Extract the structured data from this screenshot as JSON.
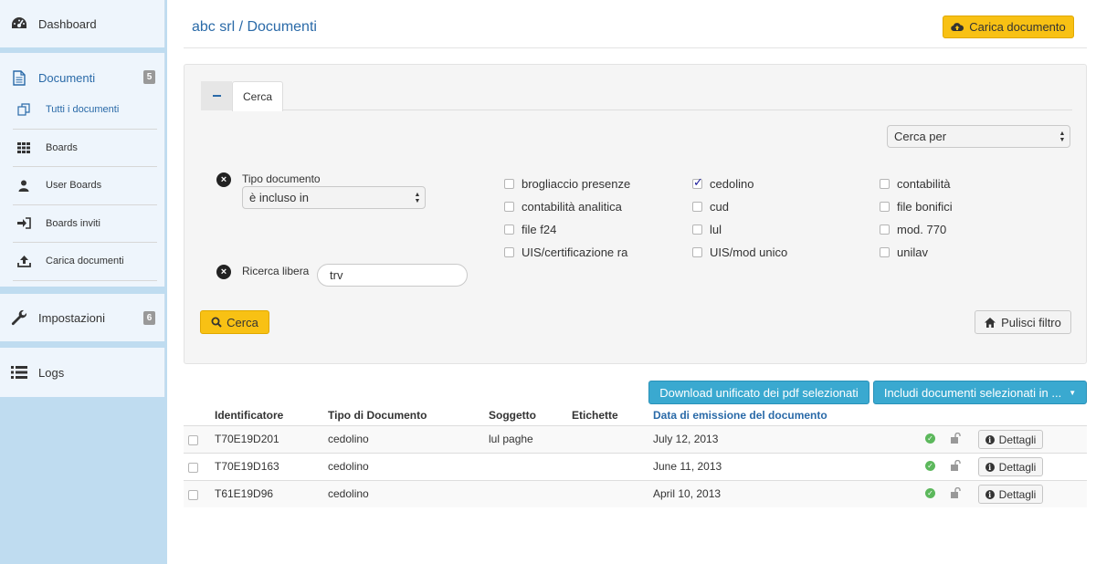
{
  "sidebar": {
    "dashboard": "Dashboard",
    "documenti": {
      "label": "Documenti",
      "badge": "5"
    },
    "sub_items": [
      {
        "label": "Tutti i documenti",
        "icon": "copy-icon"
      },
      {
        "label": "Boards",
        "icon": "grid-icon"
      },
      {
        "label": "User Boards",
        "icon": "user-icon"
      },
      {
        "label": "Boards inviti",
        "icon": "sign-in-icon"
      },
      {
        "label": "Carica documenti",
        "icon": "upload-icon"
      }
    ],
    "impostazioni": {
      "label": "Impostazioni",
      "badge": "6"
    },
    "logs": "Logs"
  },
  "header": {
    "breadcrumb": "abc srl / Documenti",
    "upload_label": "Carica documento"
  },
  "search": {
    "tab_label": "Cerca",
    "cerca_per": "Cerca per",
    "tipo_label": "Tipo documento",
    "tipo_operator": "è incluso in",
    "free_label": "Ricerca libera",
    "free_value": "trv",
    "checkboxes": [
      {
        "label": "brogliaccio presenze",
        "checked": false
      },
      {
        "label": "cedolino",
        "checked": true
      },
      {
        "label": "contabilità",
        "checked": false
      },
      {
        "label": "contabilità analitica",
        "checked": false
      },
      {
        "label": "cud",
        "checked": false
      },
      {
        "label": "file bonifici",
        "checked": false
      },
      {
        "label": "file f24",
        "checked": false
      },
      {
        "label": "lul",
        "checked": false
      },
      {
        "label": "mod. 770",
        "checked": false
      },
      {
        "label": "UIS/certificazione ra",
        "checked": false
      },
      {
        "label": "UIS/mod unico",
        "checked": false
      },
      {
        "label": "unilav",
        "checked": false
      }
    ],
    "search_button": "Cerca",
    "clear_button": "Pulisci filtro"
  },
  "actions": {
    "download": "Download unificato dei pdf selezionati",
    "include": "Includi documenti selezionati in ..."
  },
  "table": {
    "headers": {
      "id": "Identificatore",
      "tipo": "Tipo di Documento",
      "soggetto": "Soggetto",
      "etichette": "Etichette",
      "data": "Data di emissione del documento"
    },
    "details_label": "Dettagli",
    "rows": [
      {
        "id": "T70E19D201",
        "tipo": "cedolino",
        "soggetto": "lul paghe",
        "etichette": "",
        "data": "July 12, 2013"
      },
      {
        "id": "T70E19D163",
        "tipo": "cedolino",
        "soggetto": "",
        "etichette": "",
        "data": "June 11, 2013"
      },
      {
        "id": "T61E19D96",
        "tipo": "cedolino",
        "soggetto": "",
        "etichette": "",
        "data": "April 10, 2013"
      }
    ]
  },
  "colors": {
    "accent_blue": "#2a6aa8",
    "warning_yellow": "#f8c114",
    "info_blue": "#3aa9d0",
    "sidebar_bg": "#bfdcf0",
    "success_green": "#5cb85c"
  }
}
